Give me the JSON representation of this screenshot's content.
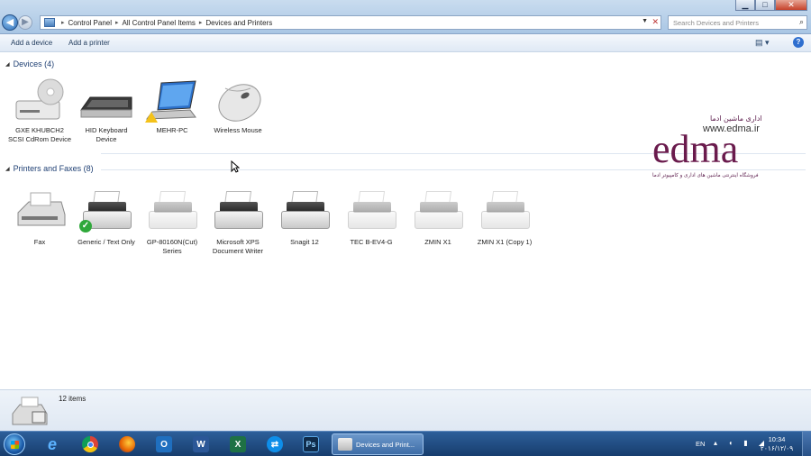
{
  "window": {
    "minimize": "▁",
    "maximize": "□",
    "close": "✕"
  },
  "address": {
    "crumbs": [
      "Control Panel",
      "All Control Panel Items",
      "Devices and Printers"
    ],
    "search_placeholder": "Search Devices and Printers"
  },
  "toolbar": {
    "add_device": "Add a device",
    "add_printer": "Add a printer"
  },
  "devices_group": {
    "title": "Devices (4)",
    "items": [
      {
        "label": "GXE KHUBCH2 SCSI CdRom Device",
        "icon": "cdrom-drive-icon"
      },
      {
        "label": "HID Keyboard Device",
        "icon": "keyboard-icon"
      },
      {
        "label": "MEHR-PC",
        "icon": "laptop-icon"
      },
      {
        "label": "Wireless Mouse",
        "icon": "mouse-icon"
      }
    ]
  },
  "printers_group": {
    "title": "Printers and Faxes (8)",
    "items": [
      {
        "label": "Fax",
        "icon": "fax-icon"
      },
      {
        "label": "Generic / Text Only",
        "icon": "printer-icon",
        "default": true
      },
      {
        "label": "GP-80160N(Cut) Series",
        "icon": "printer-icon"
      },
      {
        "label": "Microsoft XPS Document Writer",
        "icon": "printer-icon"
      },
      {
        "label": "Snagit 12",
        "icon": "printer-icon"
      },
      {
        "label": "TEC B-EV4-G",
        "icon": "printer-icon"
      },
      {
        "label": "ZMIN X1",
        "icon": "printer-icon"
      },
      {
        "label": "ZMIN X1 (Copy 1)",
        "icon": "printer-icon"
      }
    ]
  },
  "brand": {
    "persian_top": "اداری ماشین ادما",
    "url": "www.edma.ir",
    "logo_text": "edma",
    "persian_bottom": "فروشگاه اینترنتی ماشین های اداری و کامپیوتر ادما"
  },
  "details": {
    "count": "12 items"
  },
  "taskbar": {
    "apps": [
      {
        "name": "internet-explorer",
        "glyph": "e",
        "color": "#2f86d6"
      },
      {
        "name": "chrome",
        "glyph": "",
        "color": "#e8b100"
      },
      {
        "name": "firefox",
        "glyph": "",
        "color": "#e66000"
      },
      {
        "name": "outlook",
        "glyph": "O",
        "color": "#1f6fbf"
      },
      {
        "name": "word",
        "glyph": "W",
        "color": "#2b5797"
      },
      {
        "name": "excel",
        "glyph": "X",
        "color": "#1e7145"
      },
      {
        "name": "teamviewer",
        "glyph": "⇄",
        "color": "#0e8ee9"
      },
      {
        "name": "photoshop",
        "glyph": "Ps",
        "color": "#0f2b4a"
      }
    ],
    "active_window": "Devices and Print...",
    "lang": "EN",
    "time": "10:34",
    "date": "۲۰۱۶/۱۲/۰۹"
  }
}
